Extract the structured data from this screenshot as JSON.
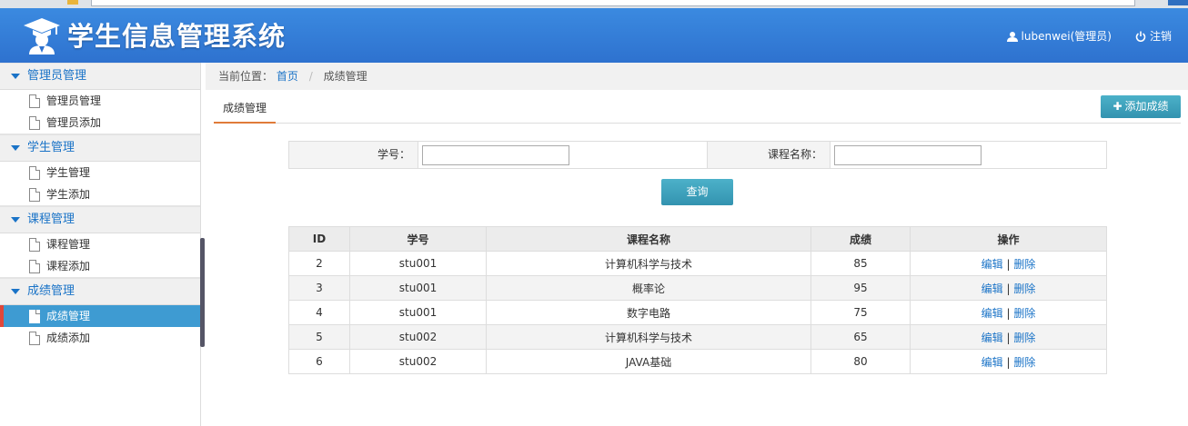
{
  "header": {
    "title": "学生信息管理系统",
    "user": "lubenwei(管理员)",
    "logout": "注销"
  },
  "sidebar": {
    "groups": [
      {
        "title": "管理员管理",
        "items": [
          "管理员管理",
          "管理员添加"
        ]
      },
      {
        "title": "学生管理",
        "items": [
          "学生管理",
          "学生添加"
        ]
      },
      {
        "title": "课程管理",
        "items": [
          "课程管理",
          "课程添加"
        ]
      },
      {
        "title": "成绩管理",
        "items": [
          "成绩管理",
          "成绩添加"
        ]
      }
    ],
    "active_item": "成绩管理"
  },
  "breadcrumb": {
    "prefix": "当前位置：",
    "home": "首页",
    "separator": "/",
    "current": "成绩管理"
  },
  "tab": {
    "label": "成绩管理"
  },
  "add_button": {
    "label": "添加成绩"
  },
  "search": {
    "student_id_label": "学号：",
    "student_id_value": "",
    "course_label": "课程名称：",
    "course_value": "",
    "query_label": "查询"
  },
  "table": {
    "headers": [
      "ID",
      "学号",
      "课程名称",
      "成绩",
      "操作"
    ],
    "rows": [
      {
        "id": "2",
        "sno": "stu001",
        "course": "计算机科学与技术",
        "score": "85"
      },
      {
        "id": "3",
        "sno": "stu001",
        "course": "概率论",
        "score": "95"
      },
      {
        "id": "4",
        "sno": "stu001",
        "course": "数字电路",
        "score": "75"
      },
      {
        "id": "5",
        "sno": "stu002",
        "course": "计算机科学与技术",
        "score": "65"
      },
      {
        "id": "6",
        "sno": "stu002",
        "course": "JAVA基础",
        "score": "80"
      }
    ],
    "edit_label": "编辑",
    "action_sep": "|",
    "delete_label": "删除"
  },
  "colors": {
    "header": "#2e72cf",
    "accent": "#3393b0",
    "link": "#1a73c7",
    "active_item": "#3e9bd2"
  }
}
